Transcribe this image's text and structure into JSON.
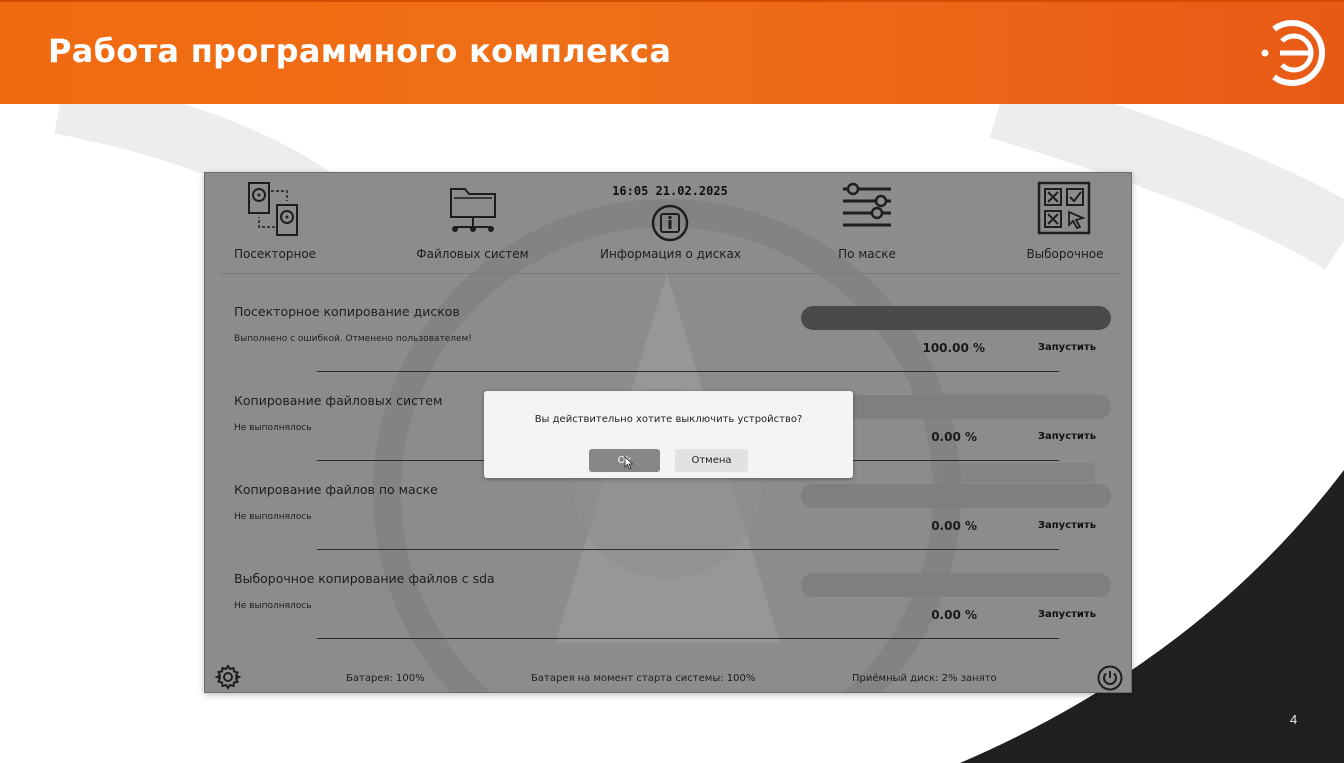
{
  "slide": {
    "title": "Работа программного комплекса",
    "page_number": "4",
    "brand_color": "#ef6a16"
  },
  "app": {
    "nav": [
      {
        "label": "Посекторное",
        "icon": "hard-drives-icon"
      },
      {
        "label": "Файловых систем",
        "icon": "folder-network-icon"
      },
      {
        "label": "Информация о дисках",
        "icon": "info-icon"
      },
      {
        "label": "По маске",
        "icon": "sliders-icon"
      },
      {
        "label": "Выборочное",
        "icon": "checkbox-grid-icon"
      }
    ],
    "datetime": "16:05 21.02.2025",
    "tasks": [
      {
        "title": "Посекторное копирование дисков",
        "status": "Выполнено с ошибкой. Отменено пользователем!",
        "percent_text": "100.00 %",
        "progress": 1.0,
        "action": "Запустить"
      },
      {
        "title": "Копирование файловых систем",
        "status": "Не выполнялось",
        "percent_text": "0.00 %",
        "progress": 0.0,
        "action": "Запустить"
      },
      {
        "title": "Копирование файлов по маске",
        "status": "Не выполнялось",
        "percent_text": "0.00 %",
        "progress": 0.0,
        "action": "Запустить"
      },
      {
        "title": "Выборочное копирование файлов с sda",
        "status": "Не выполнялось",
        "percent_text": "0.00 %",
        "progress": 0.0,
        "action": "Запустить"
      }
    ],
    "footer": {
      "battery": "Батарея: 100%",
      "battery_at_start": "Батарея на момент старта системы: 100%",
      "receiver_disk": "Приёмный диск: 2% занято"
    }
  },
  "dialog": {
    "message": "Вы действительно хотите выключить устройство?",
    "ok_label": "Ok",
    "cancel_label": "Отмена"
  }
}
